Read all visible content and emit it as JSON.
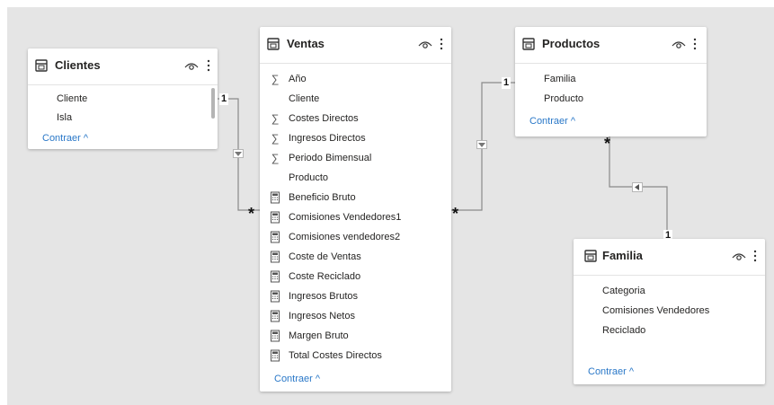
{
  "tables": {
    "clientes": {
      "title": "Clientes",
      "fields": [
        "Cliente",
        "Isla"
      ],
      "collapse_label": "Contraer ^"
    },
    "ventas": {
      "title": "Ventas",
      "fields": [
        {
          "label": "Año",
          "icon": "sigma-icon"
        },
        {
          "label": "Cliente",
          "icon": "none"
        },
        {
          "label": "Costes Directos",
          "icon": "sigma-icon"
        },
        {
          "label": "Ingresos Directos",
          "icon": "sigma-icon"
        },
        {
          "label": "Periodo Bimensual",
          "icon": "sigma-icon"
        },
        {
          "label": "Producto",
          "icon": "none"
        },
        {
          "label": "Beneficio Bruto",
          "icon": "calculator-icon"
        },
        {
          "label": "Comisiones Vendedores1",
          "icon": "calculator-icon"
        },
        {
          "label": "Comisiones vendedores2",
          "icon": "calculator-icon"
        },
        {
          "label": "Coste de Ventas",
          "icon": "calculator-icon"
        },
        {
          "label": "Coste Reciclado",
          "icon": "calculator-icon"
        },
        {
          "label": "Ingresos Brutos",
          "icon": "calculator-icon"
        },
        {
          "label": "Ingresos Netos",
          "icon": "calculator-icon"
        },
        {
          "label": "Margen Bruto",
          "icon": "calculator-icon"
        },
        {
          "label": "Total Costes Directos",
          "icon": "calculator-icon"
        }
      ],
      "collapse_label": "Contraer ^"
    },
    "productos": {
      "title": "Productos",
      "fields": [
        "Familia",
        "Producto"
      ],
      "collapse_label": "Contraer ^"
    },
    "familia": {
      "title": "Familia",
      "fields": [
        "Categoria",
        "Comisiones Vendedores",
        "Reciclado"
      ],
      "collapse_label": "Contraer ^"
    }
  },
  "relationships": {
    "clientes_ventas": {
      "one": "1",
      "many": "*"
    },
    "ventas_productos": {
      "one": "1",
      "many": "*"
    },
    "productos_familia": {
      "one": "1",
      "many": "*"
    }
  },
  "colors": {
    "canvas": "#e5e5e5",
    "card": "#ffffff",
    "link": "#2a78c8",
    "line": "#8a8a8a"
  }
}
